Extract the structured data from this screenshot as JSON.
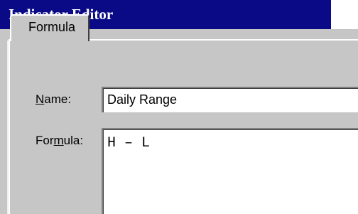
{
  "window": {
    "title": "Indicator Editor"
  },
  "tabs": [
    {
      "label": "Formula",
      "active": true
    }
  ],
  "form": {
    "name_label": "Name:",
    "name_mnemonic": "N",
    "name_label_rest": "ame:",
    "name_value": "Daily Range",
    "formula_label": "Formula:",
    "formula_label_pre": "For",
    "formula_mnemonic": "m",
    "formula_label_post": "ula:",
    "formula_value": "H – L"
  },
  "colors": {
    "titlebar": "#0a0a86",
    "dialog_face": "#c6c6c6",
    "field_background": "#ffffff"
  }
}
